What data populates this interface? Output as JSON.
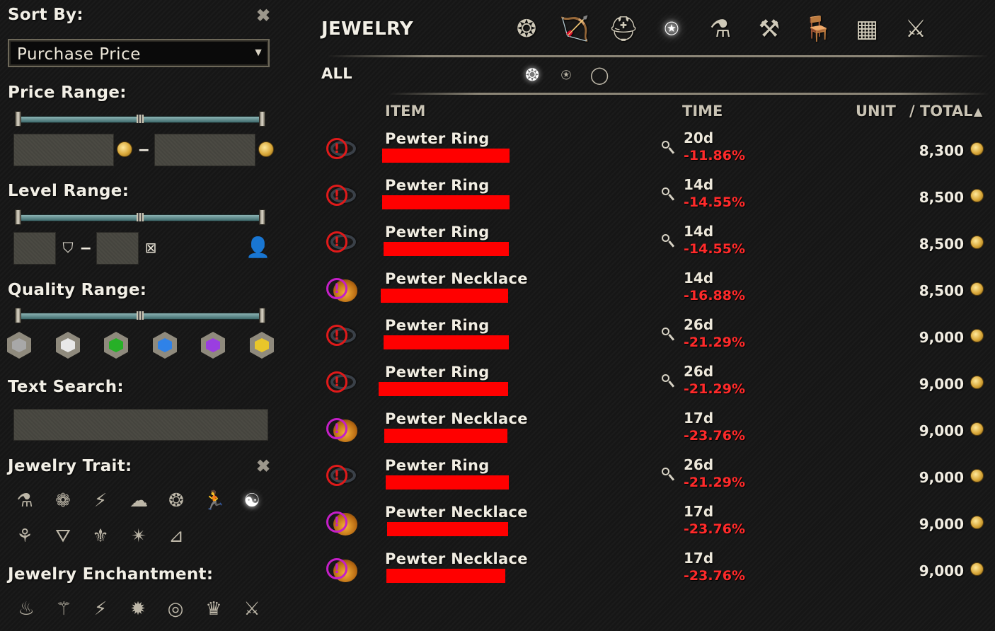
{
  "filters": {
    "sort_by_label": "Sort By:",
    "sort_value": "Purchase Price",
    "price_range_label": "Price Range:",
    "level_range_label": "Level Range:",
    "quality_range_label": "Quality Range:",
    "text_search_label": "Text Search:",
    "text_search_value": "",
    "price_min": "",
    "price_max": "",
    "level_min": "",
    "level_max": "",
    "trait_label": "Jewelry Trait:",
    "enchantment_label": "Jewelry Enchantment:",
    "dash": "–",
    "quality_colors": [
      "#a8a8a8",
      "#e8e8e8",
      "#27b027",
      "#2f82e8",
      "#9a3ee0",
      "#e8c62a"
    ]
  },
  "header": {
    "category_title": "JEWELRY",
    "subcategory_label": "ALL",
    "col_item": "ITEM",
    "col_time": "TIME",
    "col_unit": "UNIT",
    "col_total": "/ TOTAL",
    "sort_arrow": "▲"
  },
  "listings": [
    {
      "name": "Pewter Ring",
      "type": "ring",
      "time": "20d",
      "pct": "-11.86%",
      "price": "8,300",
      "inspect": true
    },
    {
      "name": "Pewter Ring",
      "type": "ring",
      "time": "14d",
      "pct": "-14.55%",
      "price": "8,500",
      "inspect": true
    },
    {
      "name": "Pewter Ring",
      "type": "ring",
      "time": "14d",
      "pct": "-14.55%",
      "price": "8,500",
      "inspect": true
    },
    {
      "name": "Pewter Necklace",
      "type": "necklace",
      "time": "14d",
      "pct": "-16.88%",
      "price": "8,500",
      "inspect": false
    },
    {
      "name": "Pewter Ring",
      "type": "ring",
      "time": "26d",
      "pct": "-21.29%",
      "price": "9,000",
      "inspect": true
    },
    {
      "name": "Pewter Ring",
      "type": "ring",
      "time": "26d",
      "pct": "-21.29%",
      "price": "9,000",
      "inspect": true
    },
    {
      "name": "Pewter Necklace",
      "type": "necklace",
      "time": "17d",
      "pct": "-23.76%",
      "price": "9,000",
      "inspect": false
    },
    {
      "name": "Pewter Ring",
      "type": "ring",
      "time": "26d",
      "pct": "-21.29%",
      "price": "9,000",
      "inspect": true
    },
    {
      "name": "Pewter Necklace",
      "type": "necklace",
      "time": "17d",
      "pct": "-23.76%",
      "price": "9,000",
      "inspect": false
    },
    {
      "name": "Pewter Necklace",
      "type": "necklace",
      "time": "17d",
      "pct": "-23.76%",
      "price": "9,000",
      "inspect": false
    }
  ]
}
